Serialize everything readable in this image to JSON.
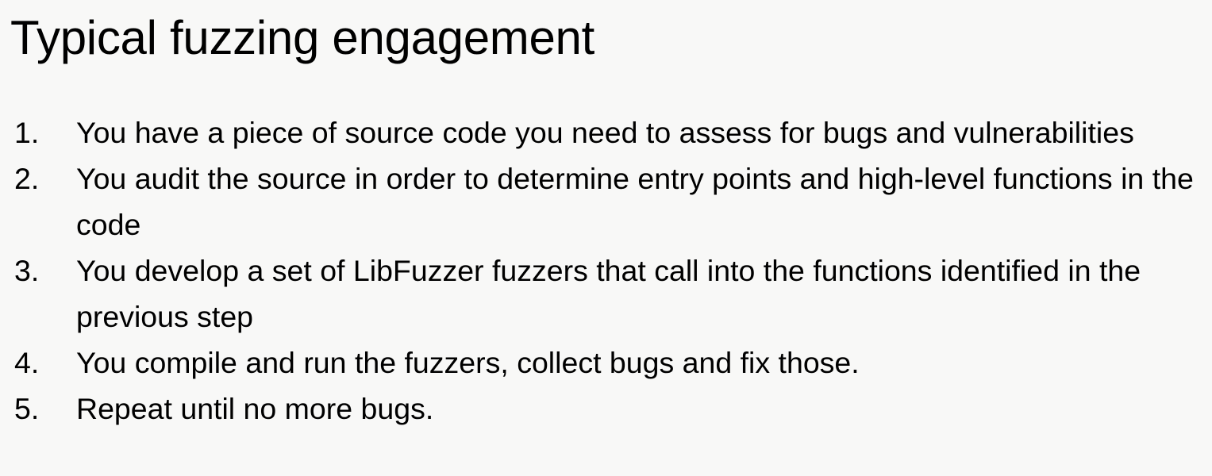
{
  "slide": {
    "title": "Typical fuzzing engagement",
    "steps": [
      {
        "number": "1.",
        "text": "You have a piece of source code you need to assess for bugs and vulnerabilities"
      },
      {
        "number": "2.",
        "text": "You audit the source in order to determine entry points and high-level functions in the code"
      },
      {
        "number": "3.",
        "text": "You develop a set of LibFuzzer fuzzers that call into the functions identified in the previous step"
      },
      {
        "number": "4.",
        "text": "You compile and run the fuzzers, collect bugs and fix those."
      },
      {
        "number": "5.",
        "text": "Repeat until no more bugs."
      }
    ]
  }
}
